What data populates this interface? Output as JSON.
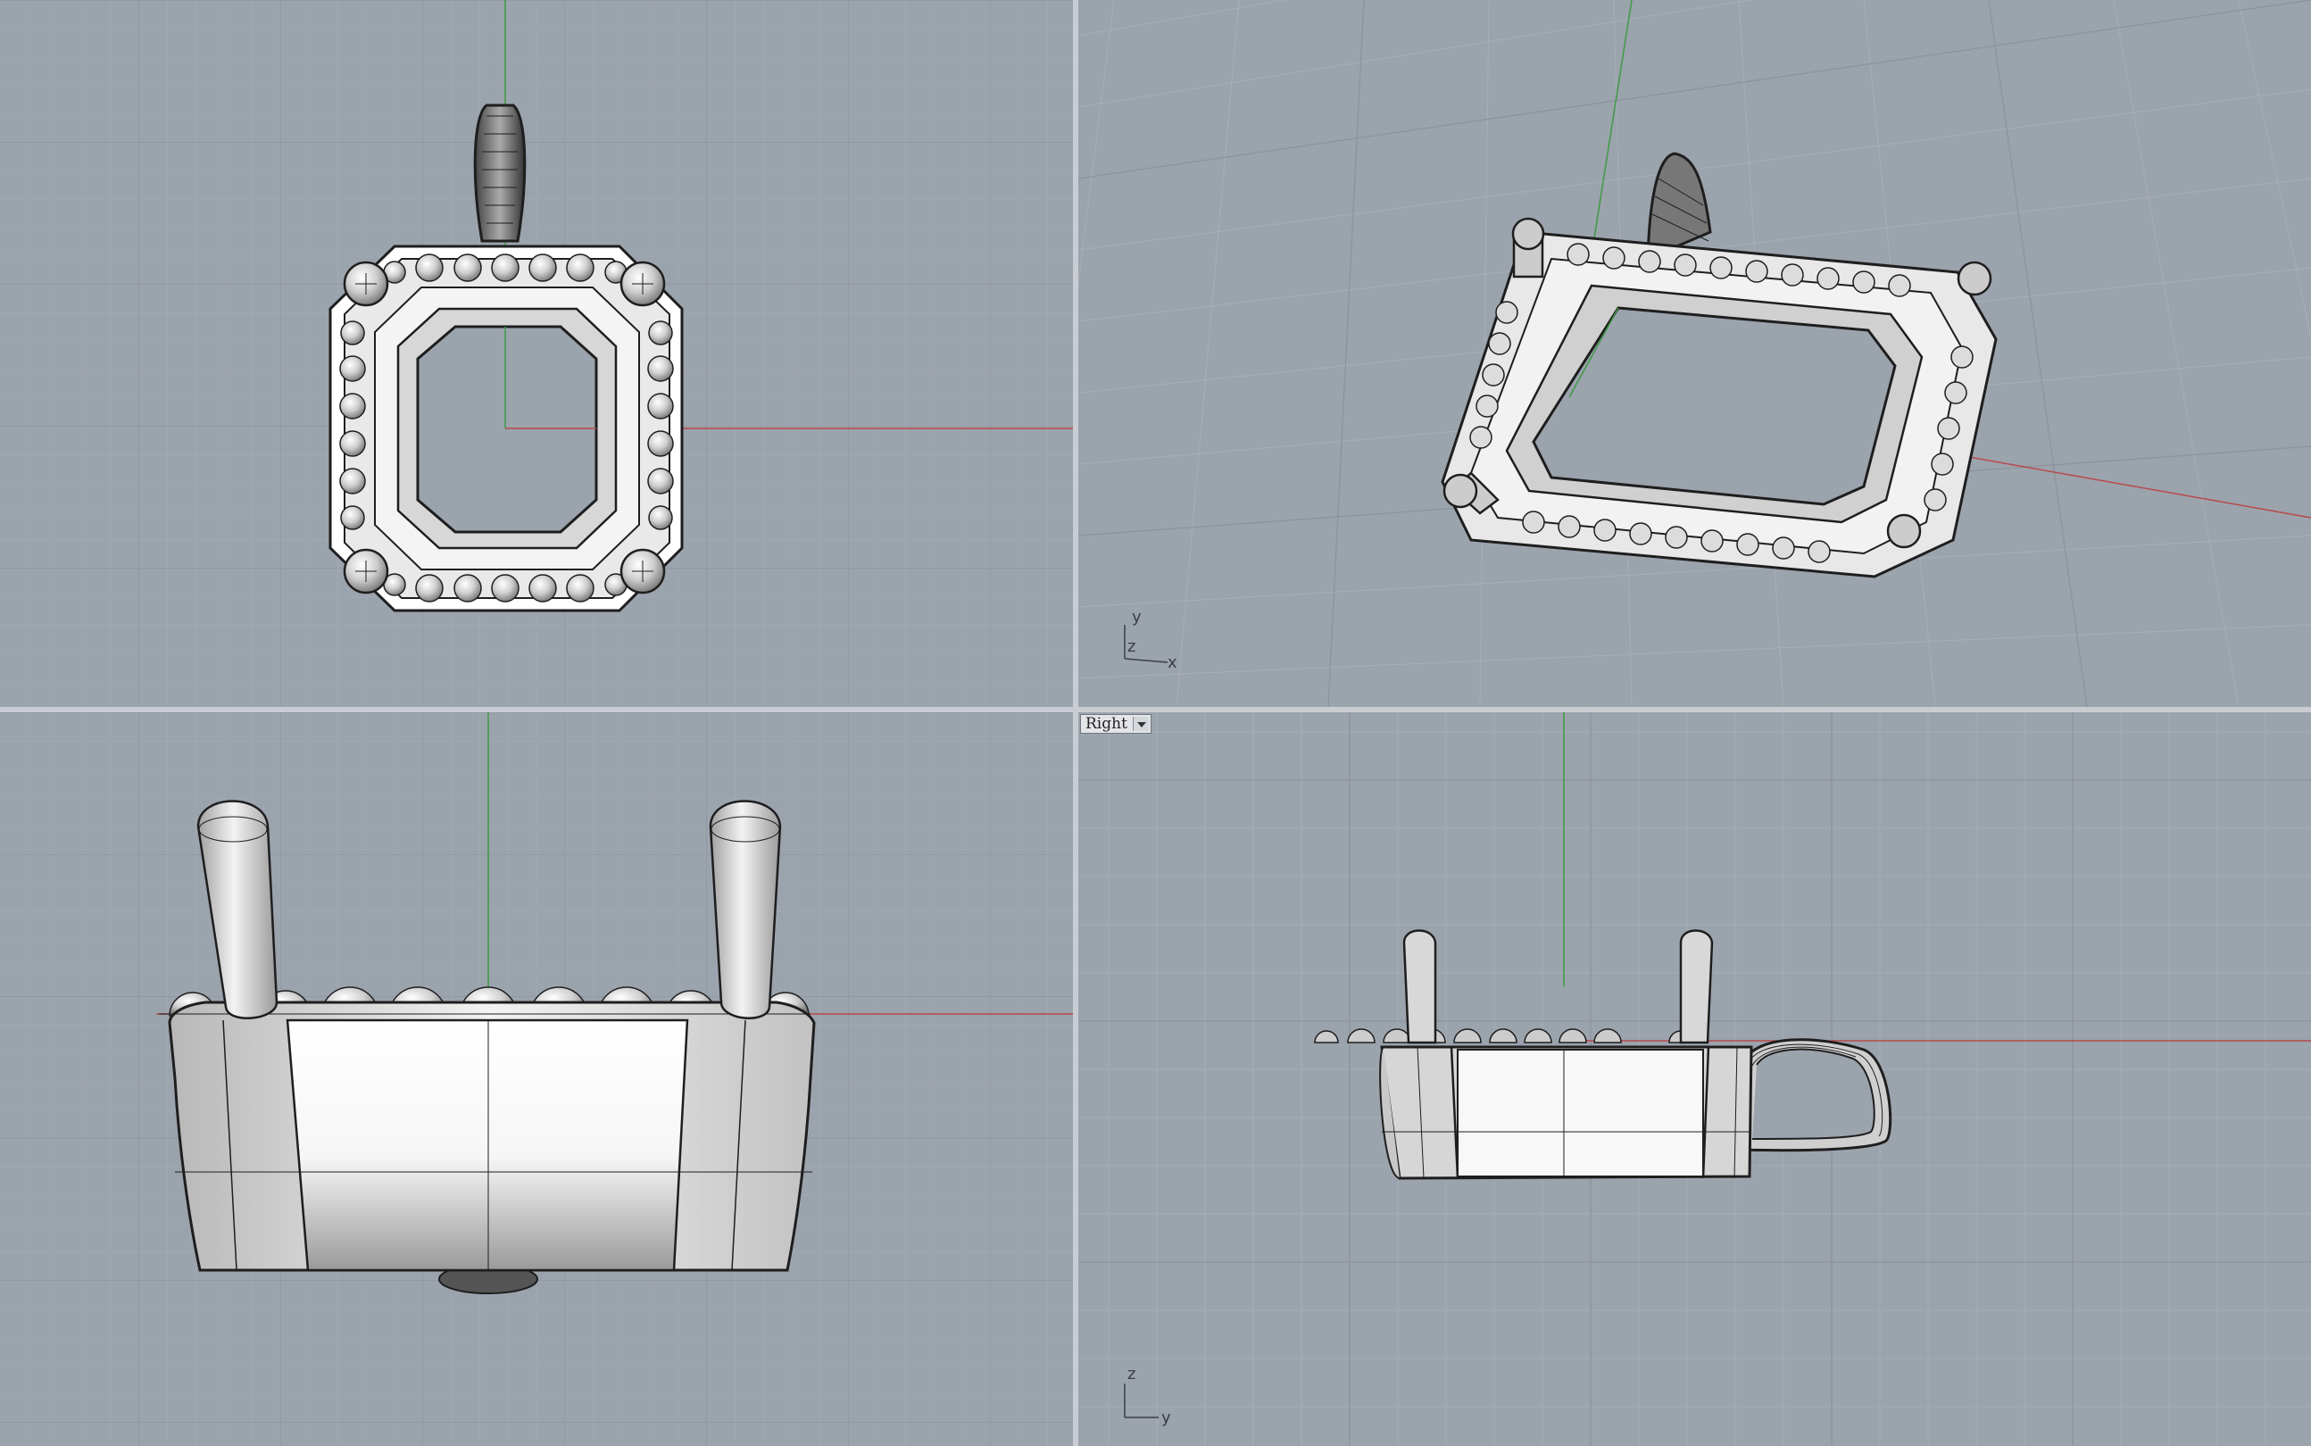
{
  "viewports": {
    "top": {
      "title": ""
    },
    "perspective": {
      "title": ""
    },
    "front": {
      "title": ""
    },
    "right": {
      "title": "Right"
    }
  },
  "axis_indicators": {
    "perspective": {
      "a": "y",
      "b": "z",
      "c": "x"
    },
    "right": {
      "a": "z",
      "b": "y"
    }
  },
  "colors": {
    "viewport_bg": "#9ba3ad",
    "grid_minor": "#a7aeb7",
    "grid_major": "#8d949e",
    "x_axis": "#b84a4a",
    "y_axis": "#3f9a45",
    "separator": "#d5d8dd",
    "model_edge": "#1e1e1e"
  },
  "icons": [
    "dropdown-arrow-icon",
    "axis-indicator-icon"
  ]
}
